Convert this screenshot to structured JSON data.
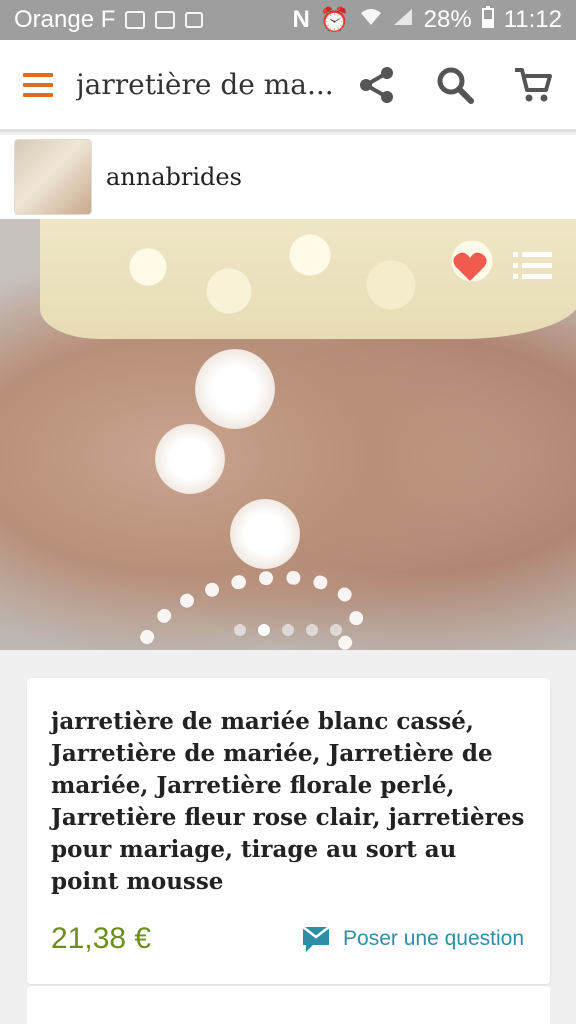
{
  "status_bar": {
    "carrier": "Orange F",
    "battery": "28%",
    "time": "11:12"
  },
  "app_bar": {
    "title": "jarretière de ma...",
    "menu_icon": "hamburger-menu-icon",
    "share_icon": "share-icon",
    "search_icon": "search-icon",
    "cart_icon": "cart-icon",
    "accent_color": "#e36b1d"
  },
  "shop": {
    "name": "annabrides"
  },
  "gallery": {
    "image_count": 5,
    "active_index": 1,
    "favorite_color": "#f05a4f"
  },
  "listing": {
    "title": "jarretière de mariée blanc cassé, Jarretière de mariée, Jarretière de mariée, Jarretière florale perlé, Jarretière fleur rose clair, jarretières pour mariage, tirage au sort au point mousse",
    "price": "21,38 €",
    "price_color": "#6c8e1c",
    "ask_question_label": "Poser une question",
    "link_color": "#2e8ea8"
  }
}
